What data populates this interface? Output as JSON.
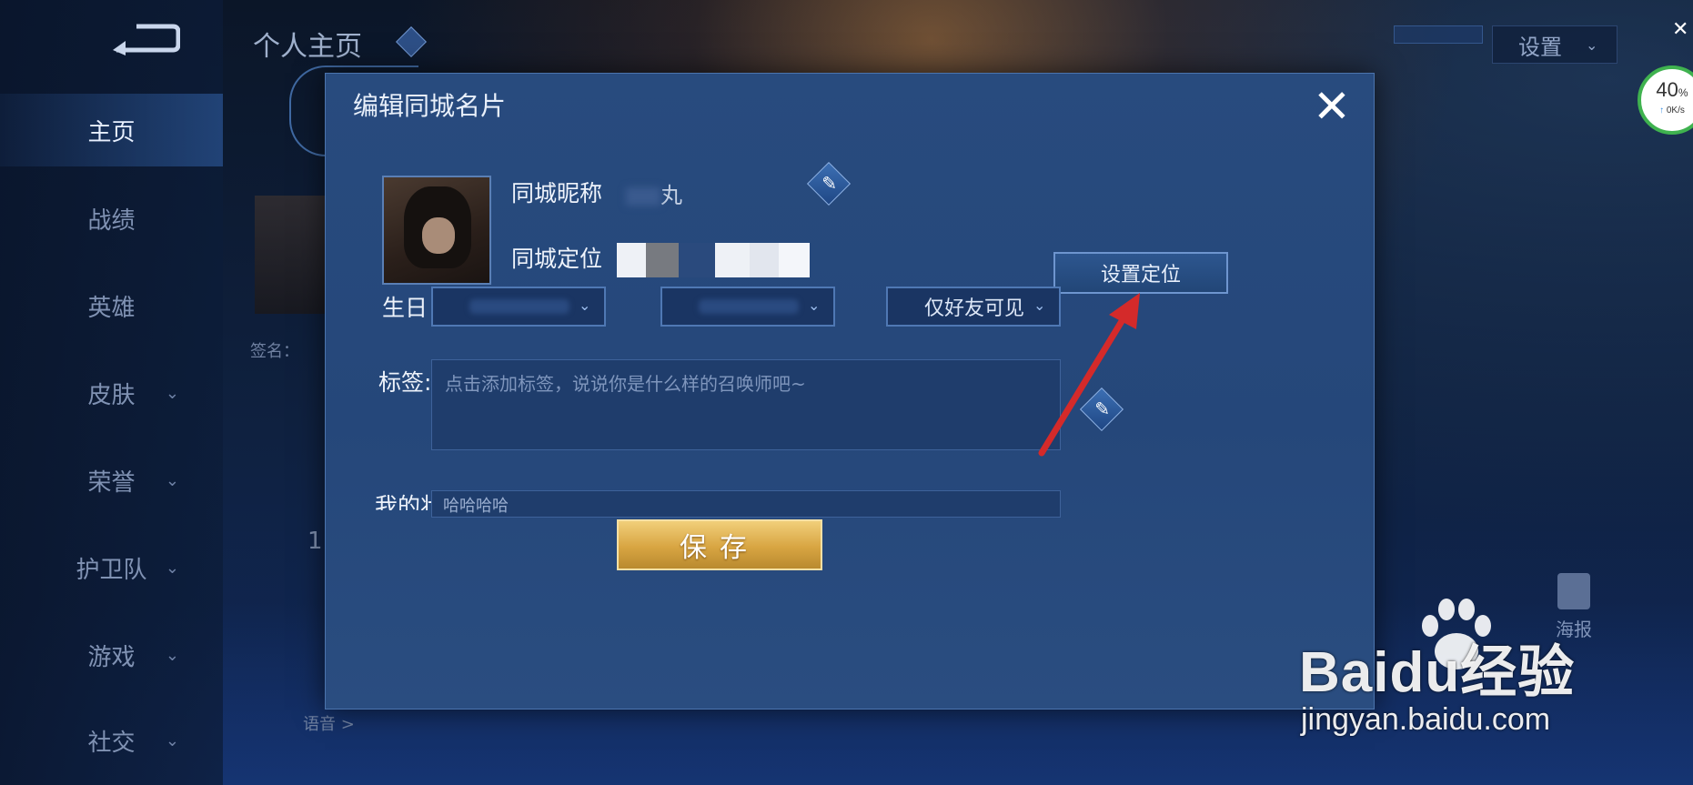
{
  "sidebar": {
    "items": [
      {
        "label": "主页"
      },
      {
        "label": "战绩"
      },
      {
        "label": "英雄"
      },
      {
        "label": "皮肤"
      },
      {
        "label": "荣誉"
      },
      {
        "label": "护卫队"
      },
      {
        "label": "游戏"
      },
      {
        "label": "社交"
      }
    ],
    "active": "主页"
  },
  "header": {
    "title": "个人主页",
    "settings_label": "设置"
  },
  "background": {
    "sign_label": "签名：",
    "voice_label": "语音 >",
    "number": "1",
    "poster_label": "海报"
  },
  "net_meter": {
    "percent": "40",
    "percent_sign": "%",
    "speed": "0K/s"
  },
  "modal": {
    "title": "编辑同城名片",
    "nickname_label": "同城昵称",
    "nickname_value": "丸",
    "location_label": "同城定位",
    "set_location_button": "设置定位",
    "birthday_label": "生日",
    "visibility_select": "仅好友可见",
    "tags_label": "标签:",
    "tags_placeholder": "点击添加标签，说说你是什么样的召唤师吧~",
    "status_label": "我的状态",
    "status_value": "哈哈哈哈",
    "save_button": "保存"
  },
  "watermark": {
    "brand": "Baidu经验",
    "url": "jingyan.baidu.com"
  },
  "colors": {
    "modal_bg": "#25477a",
    "save_gold": "#d8a542",
    "annotation_red": "#d42a2a"
  }
}
